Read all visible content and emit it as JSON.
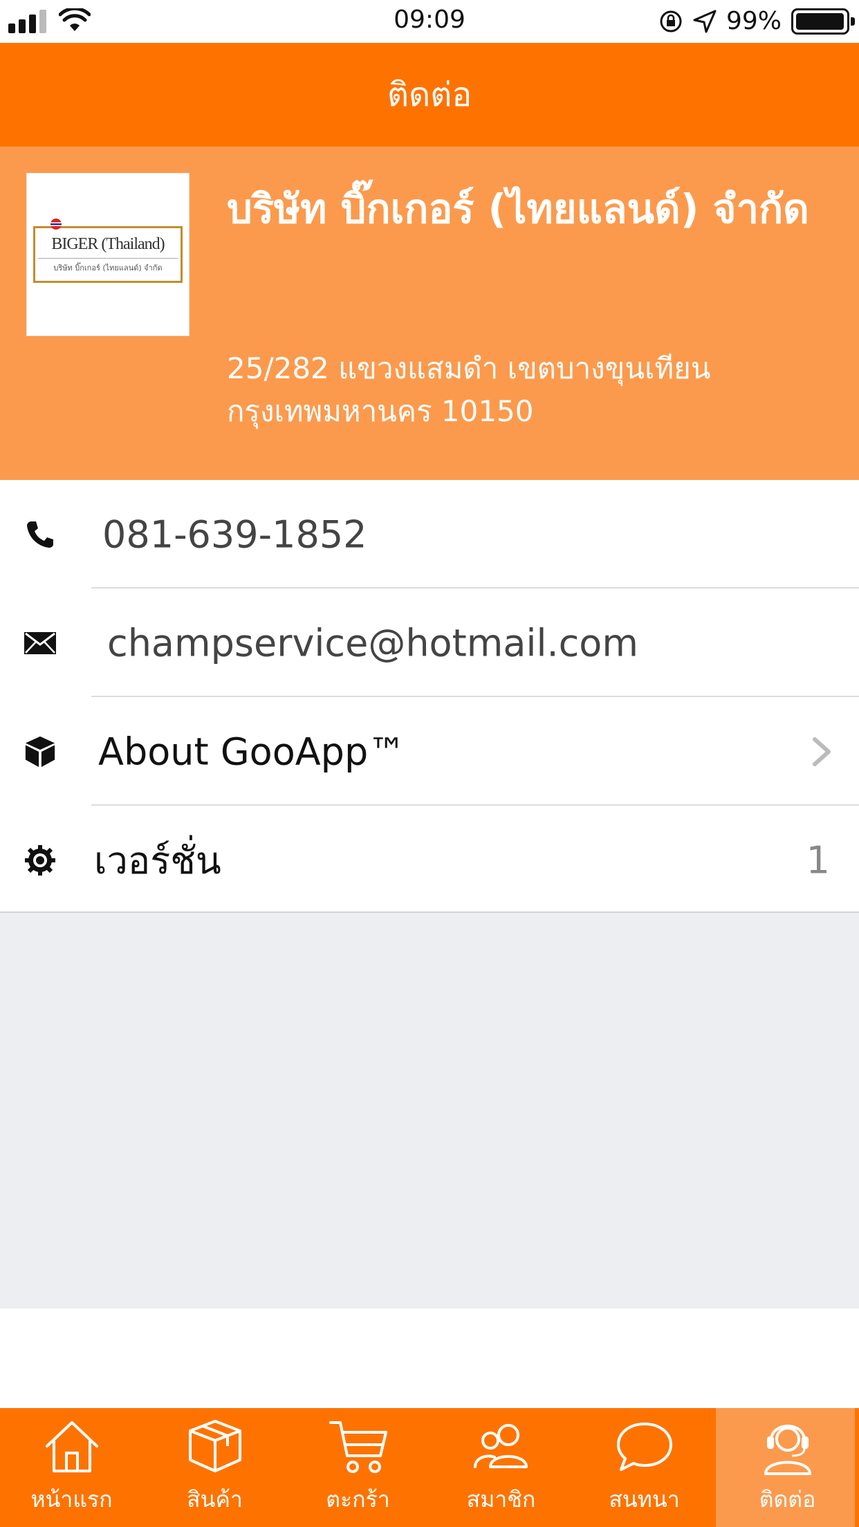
{
  "status_bar": {
    "time": "09:09",
    "battery_percent": "99%",
    "battery_level": 0.99,
    "signal_bars": 3
  },
  "header": {
    "title": "ติดต่อ"
  },
  "company": {
    "logo": {
      "name": "BIGER (Thailand)",
      "subtitle": "บริษัท บิ๊กเกอร์ (ไทยแลนด์) จำกัด"
    },
    "name": "บริษัท บิ๊กเกอร์ (ไทยแลนด์) จำกัด",
    "address": "25/282 แขวงแสมดำ เขตบางขุนเทียน กรุงเทพมหานคร 10150"
  },
  "contact_list": {
    "phone": "081-639-1852",
    "email": "champservice@hotmail.com",
    "about": "About GooApp™",
    "version_label": "เวอร์ชั่น",
    "version_value": "1"
  },
  "tabs": [
    {
      "label": "หน้าแรก",
      "icon": "home-icon"
    },
    {
      "label": "สินค้า",
      "icon": "box-icon"
    },
    {
      "label": "ตะกร้า",
      "icon": "cart-icon"
    },
    {
      "label": "สมาชิก",
      "icon": "users-icon"
    },
    {
      "label": "สนทนา",
      "icon": "chat-icon"
    },
    {
      "label": "ติดต่อ",
      "icon": "support-icon"
    }
  ],
  "colors": {
    "primary": "#fe7300",
    "panel": "#fb9a4d",
    "background_gray": "#eceef2"
  }
}
